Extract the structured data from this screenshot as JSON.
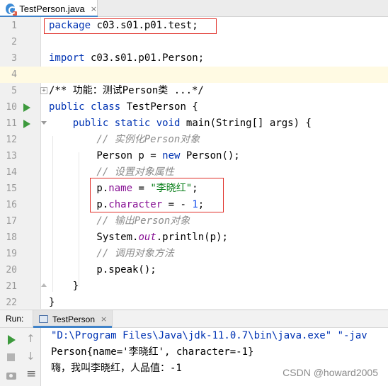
{
  "tabs": {
    "active_file": "TestPerson.java",
    "close_glyph": "×"
  },
  "editor": {
    "lines": [
      {
        "num": "1",
        "code": [
          {
            "t": "package",
            "c": "kw"
          },
          {
            "t": " c03.s01.p01.test;",
            "c": ""
          }
        ]
      },
      {
        "num": "2",
        "code": []
      },
      {
        "num": "3",
        "code": [
          {
            "t": "import",
            "c": "kw"
          },
          {
            "t": " c03.s01.p01.Person;",
            "c": ""
          }
        ]
      },
      {
        "num": "4",
        "code": [],
        "current": true
      },
      {
        "num": "5",
        "code": [
          {
            "t": "/** 功能：测试Person类 ...*/",
            "c": "cmt-plain"
          }
        ],
        "fold": "plus"
      },
      {
        "num": "10",
        "code": [
          {
            "t": "public",
            "c": "kw"
          },
          {
            "t": " ",
            "c": ""
          },
          {
            "t": "class",
            "c": "kw"
          },
          {
            "t": " TestPerson {",
            "c": ""
          }
        ],
        "run": true
      },
      {
        "num": "11",
        "code": [
          {
            "t": "    ",
            "c": ""
          },
          {
            "t": "public",
            "c": "kw"
          },
          {
            "t": " ",
            "c": ""
          },
          {
            "t": "static",
            "c": "kw"
          },
          {
            "t": " ",
            "c": ""
          },
          {
            "t": "void",
            "c": "kw"
          },
          {
            "t": " main(String[] args) {",
            "c": ""
          }
        ],
        "run": true,
        "fold": "open"
      },
      {
        "num": "12",
        "code": [
          {
            "t": "        // 实例化Person对象",
            "c": "cmt"
          }
        ]
      },
      {
        "num": "13",
        "code": [
          {
            "t": "        Person p = ",
            "c": ""
          },
          {
            "t": "new",
            "c": "kw"
          },
          {
            "t": " Person();",
            "c": ""
          }
        ]
      },
      {
        "num": "14",
        "code": [
          {
            "t": "        // 设置对象属性",
            "c": "cmt"
          }
        ]
      },
      {
        "num": "15",
        "code": [
          {
            "t": "        p.",
            "c": ""
          },
          {
            "t": "name",
            "c": "fld"
          },
          {
            "t": " = ",
            "c": ""
          },
          {
            "t": "\"李晓红\"",
            "c": "str"
          },
          {
            "t": ";",
            "c": ""
          }
        ]
      },
      {
        "num": "16",
        "code": [
          {
            "t": "        p.",
            "c": ""
          },
          {
            "t": "character",
            "c": "fld"
          },
          {
            "t": " = - ",
            "c": ""
          },
          {
            "t": "1",
            "c": "num"
          },
          {
            "t": ";",
            "c": ""
          }
        ]
      },
      {
        "num": "17",
        "code": [
          {
            "t": "        // 输出Person对象",
            "c": "cmt"
          }
        ]
      },
      {
        "num": "18",
        "code": [
          {
            "t": "        System.",
            "c": ""
          },
          {
            "t": "out",
            "c": "sfld"
          },
          {
            "t": ".println(p);",
            "c": ""
          }
        ]
      },
      {
        "num": "19",
        "code": [
          {
            "t": "        // 调用对象方法",
            "c": "cmt"
          }
        ]
      },
      {
        "num": "20",
        "code": [
          {
            "t": "        p.speak();",
            "c": ""
          }
        ]
      },
      {
        "num": "21",
        "code": [
          {
            "t": "    }",
            "c": ""
          }
        ],
        "fold": "end"
      },
      {
        "num": "22",
        "code": [
          {
            "t": "}",
            "c": ""
          }
        ]
      }
    ]
  },
  "run_panel": {
    "title": "Run:",
    "tab_label": "TestPerson",
    "close_glyph": "×",
    "console_lines": [
      "\"D:\\Program Files\\Java\\jdk-11.0.7\\bin\\java.exe\" \"-jav",
      "Person{name='李晓红', character=-1}",
      "嗨，我叫李晓红，人品值：-1"
    ]
  },
  "watermark": "CSDN @howard2005",
  "colors": {
    "keyword": "#0033b3",
    "string": "#067d17",
    "number": "#1750eb",
    "field": "#871094",
    "comment": "#8c8c8c",
    "highlight_box": "#e0302a",
    "current_line": "#fffae3"
  },
  "icons": {
    "file_tab": "java-class-icon",
    "run_gutter": "run-arrow-icon",
    "console_tab": "console-icon",
    "toolbar": [
      "rerun-icon",
      "scroll-up-icon",
      "stop-icon",
      "scroll-down-icon",
      "screenshot-icon",
      "soft-wrap-icon"
    ]
  }
}
